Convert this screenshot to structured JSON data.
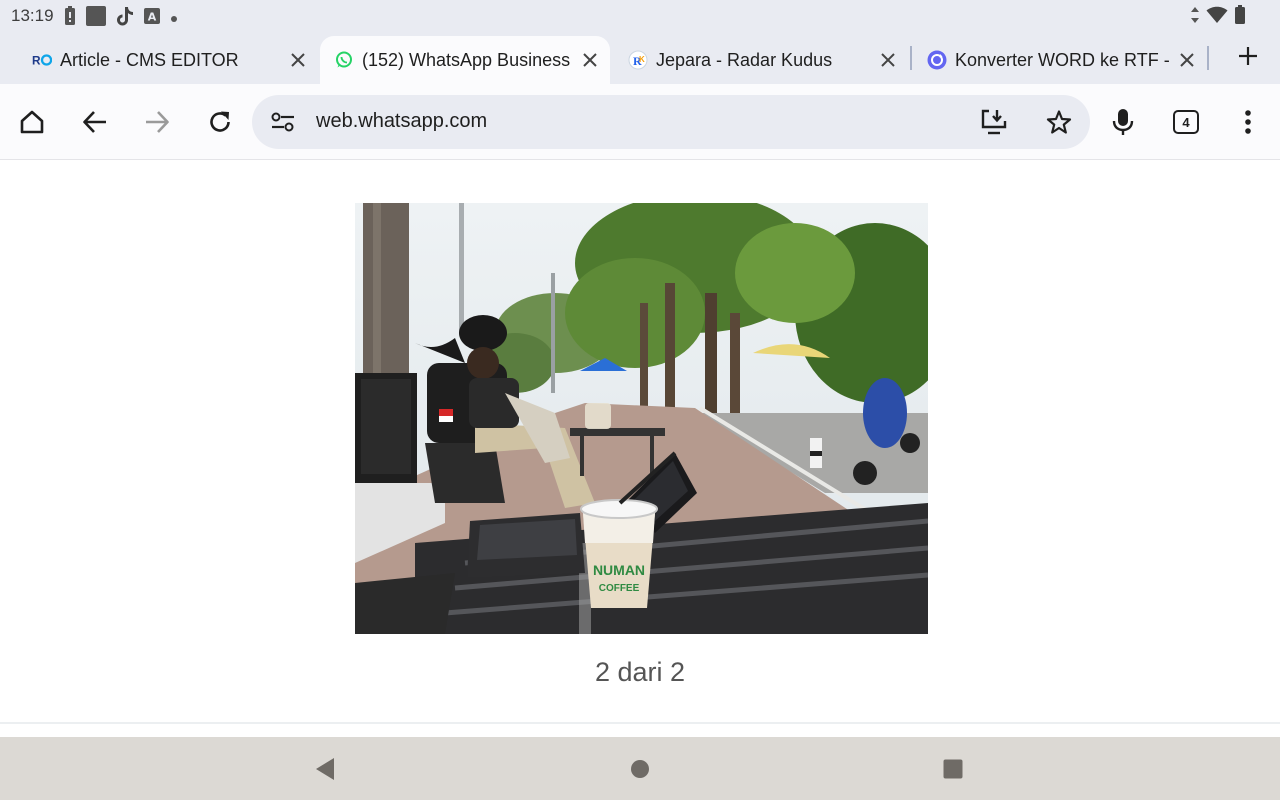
{
  "status_bar": {
    "time": "13:19",
    "left_icons": [
      "battery-saver-icon",
      "square-notification-icon",
      "tiktok-icon",
      "keyboard-a-icon",
      "dot-icon"
    ],
    "right_icons": [
      "data-arrows-icon",
      "wifi-icon",
      "battery-icon"
    ]
  },
  "tabs": [
    {
      "title": "Article - CMS EDITOR",
      "favicon": "ro-logo-icon",
      "active": false
    },
    {
      "title": "(152) WhatsApp Business",
      "favicon": "whatsapp-icon",
      "active": true
    },
    {
      "title": "Jepara - Radar Kudus",
      "favicon": "radar-kudus-icon",
      "active": false
    },
    {
      "title": "Konverter WORD ke RTF - ",
      "favicon": "converter-icon",
      "active": false
    }
  ],
  "toolbar": {
    "url": "web.whatsapp.com",
    "tab_count": "4"
  },
  "viewer": {
    "caption": "2 dari 2",
    "image_alt": "Two people sitting at an outdoor cafe table on a tree-lined sidewalk with a laptop and a Numan Coffee iced drink"
  },
  "colors": {
    "chrome_bg": "#e9ebf2",
    "active_tab_bg": "#fbfbfd",
    "nav_bar_bg": "#dcd9d4",
    "whatsapp_green": "#25d366",
    "caption_text": "#555555"
  }
}
